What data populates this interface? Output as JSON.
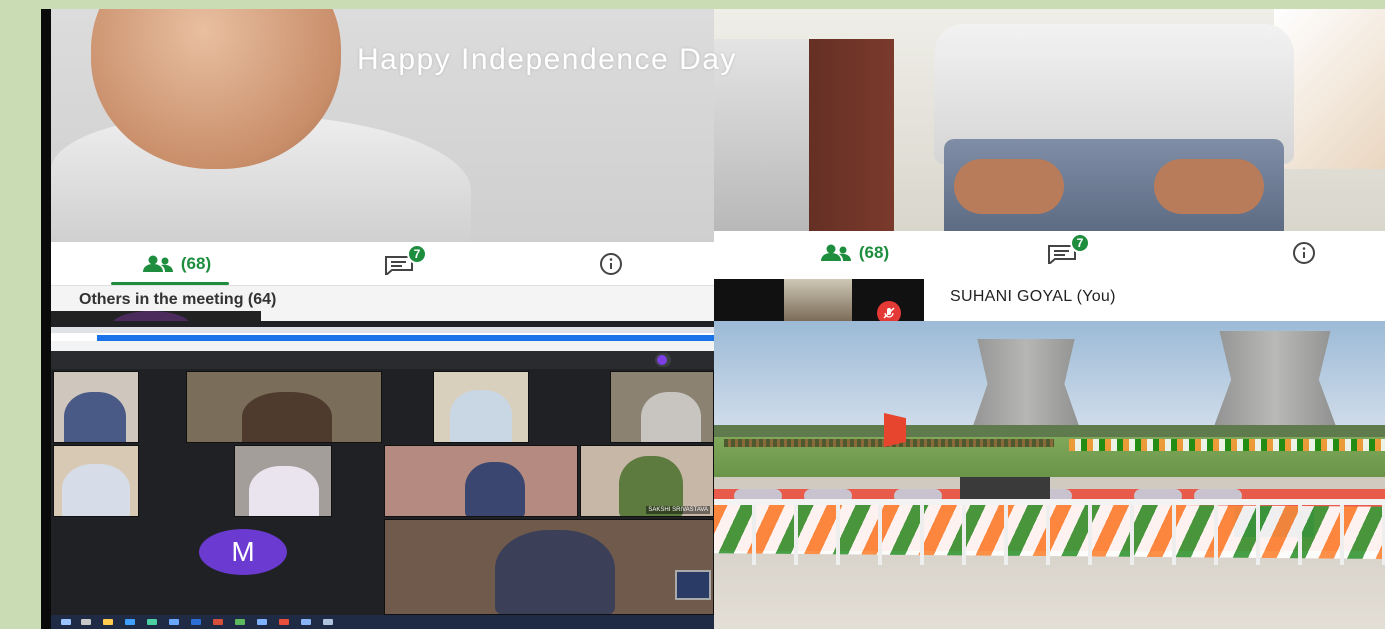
{
  "banner_text": "Happy Independence Day",
  "top_left": {
    "participants_tab": "(68)",
    "chat_badge": "7",
    "others_heading": "Others in the meeting (64)"
  },
  "top_right": {
    "participants_tab": "(68)",
    "chat_badge": "7",
    "self_name": "SUHANI GOYAL (You)"
  },
  "bottom_left": {
    "avatar_letter": "M",
    "tile_name": "SAKSHI SRIVASTAVA"
  },
  "colors": {
    "accent_green": "#1e8e3e",
    "avatar_purple": "#6a3ad1",
    "mute_red": "#e53935",
    "page_background": "#c9dcb3"
  }
}
